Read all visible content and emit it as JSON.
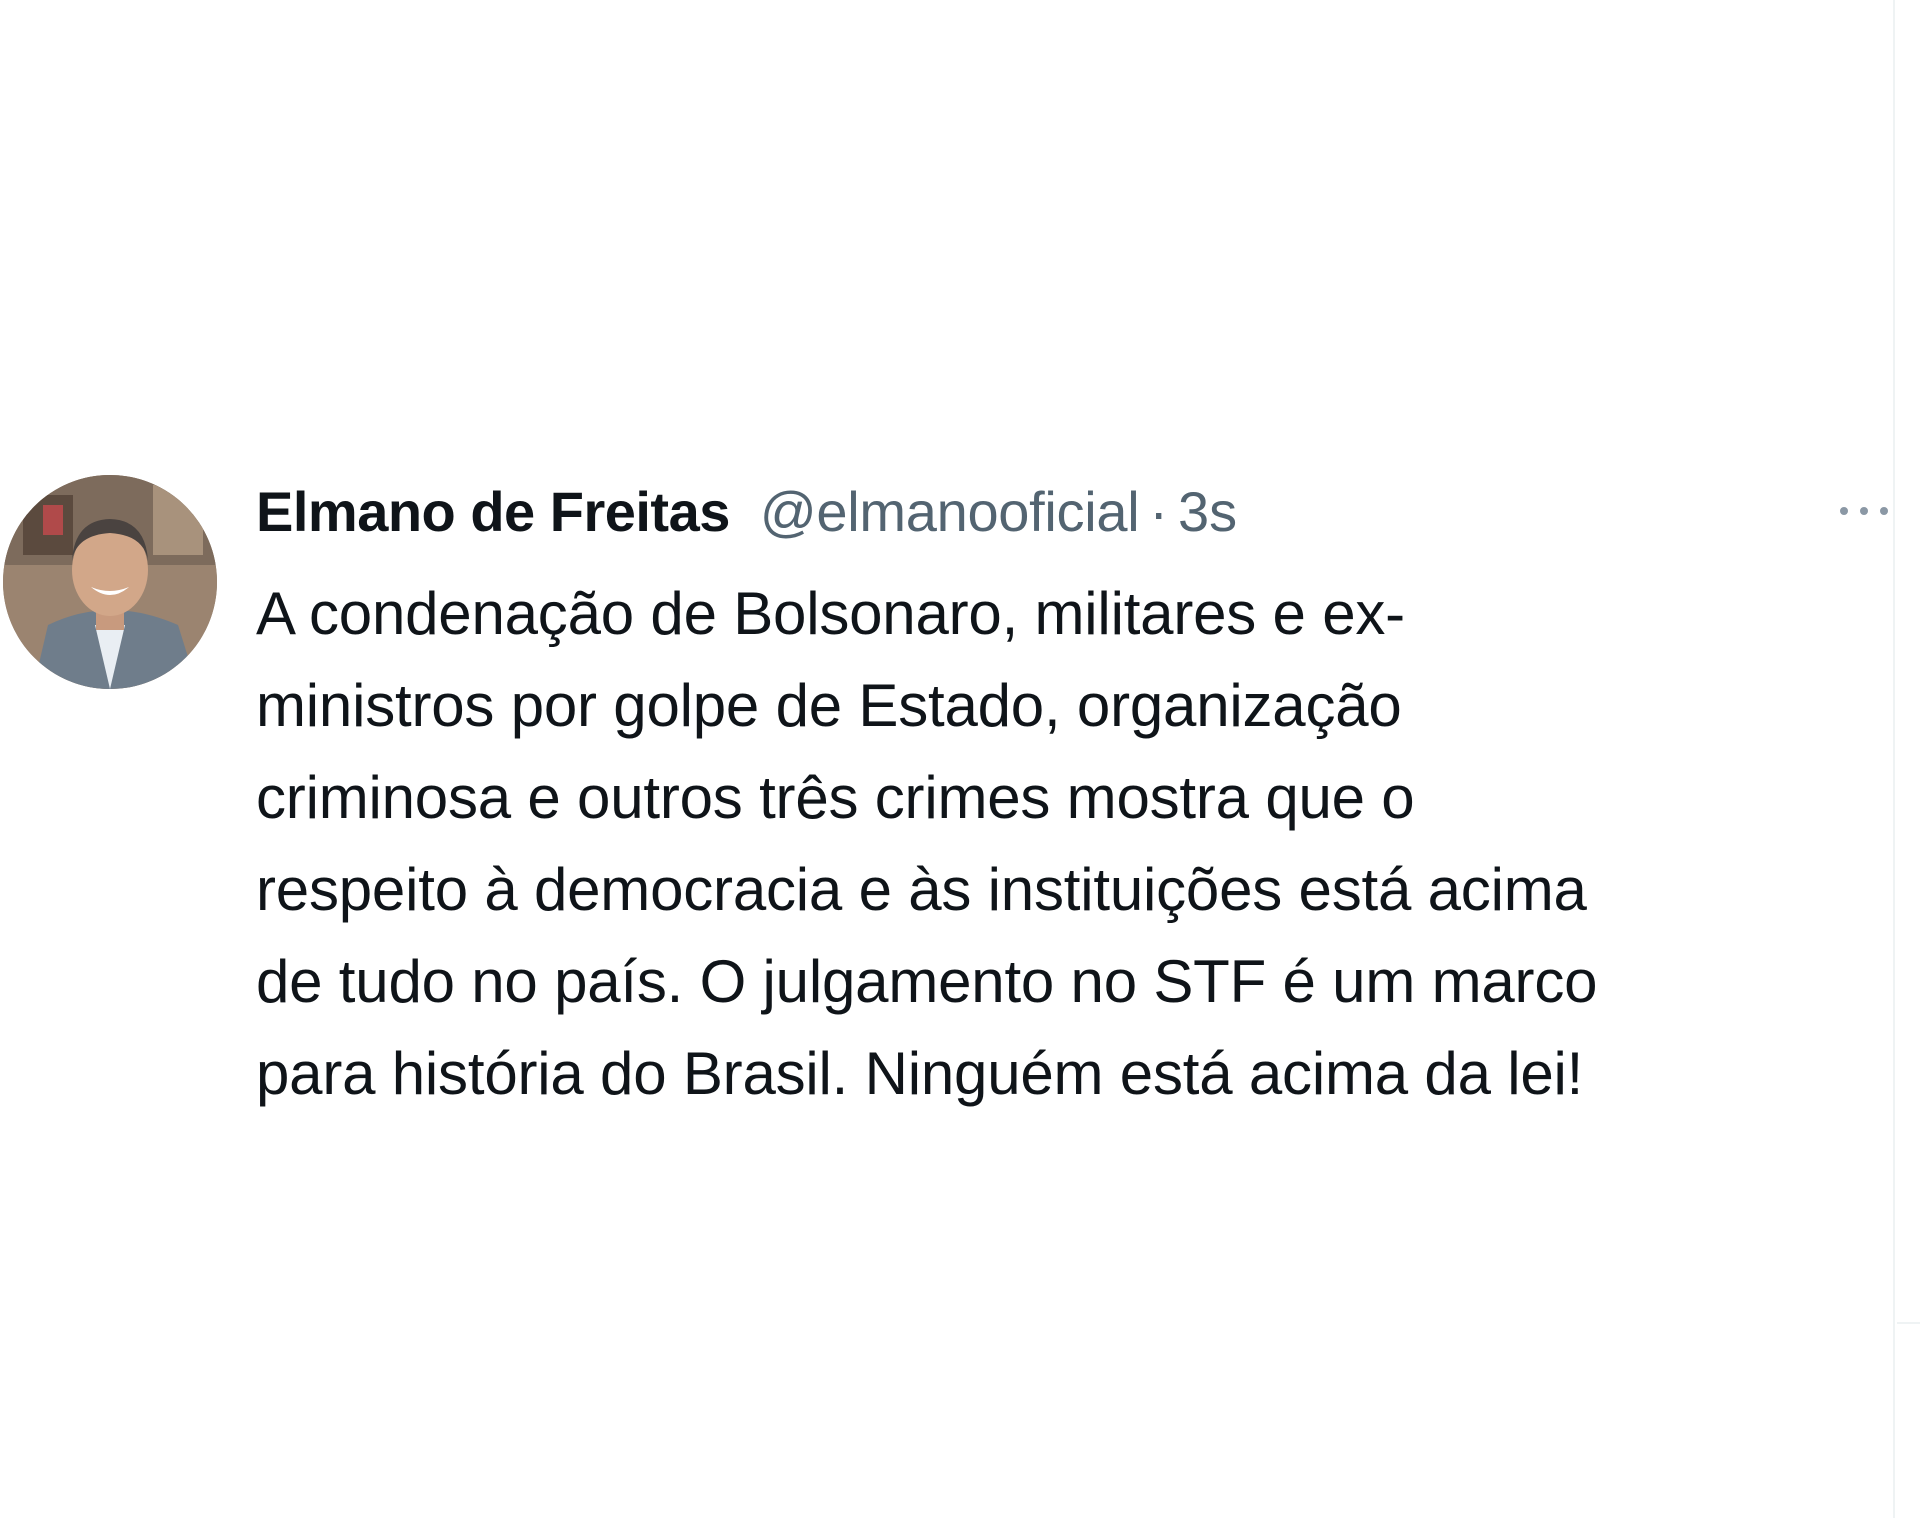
{
  "tweet": {
    "author": {
      "display_name": "Elmano de Freitas",
      "handle": "@elmanooficial",
      "avatar_icon": "profile-photo"
    },
    "separator": "·",
    "timestamp": "3s",
    "more_icon": "ellipsis-icon",
    "text_lines": [
      "A condenação de Bolsonaro, militares e ex-",
      "ministros por golpe de Estado, organização",
      "criminosa e outros três crimes mostra que o",
      "respeito à democracia e às instituições está acima",
      "de tudo no país. O julgamento no STF é um marco",
      "para história do Brasil. Ninguém está acima da lei!"
    ]
  },
  "colors": {
    "text_primary": "#0f1419",
    "text_secondary": "#536471",
    "background": "#ffffff",
    "divider": "#eff3f4"
  }
}
